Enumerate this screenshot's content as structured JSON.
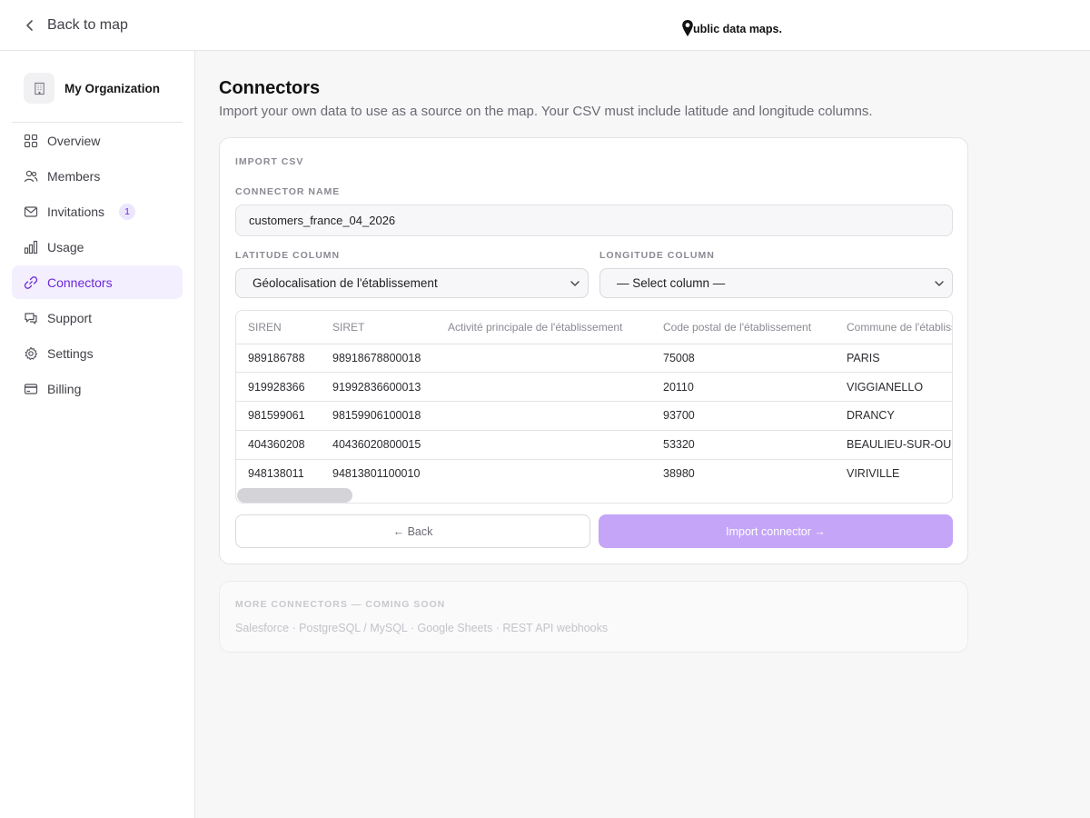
{
  "topbar": {
    "back_label": "Back to map",
    "brand": "ublic data maps."
  },
  "sidebar": {
    "org_name": "My Organization",
    "items": [
      {
        "label": "Overview",
        "icon": "grid-icon"
      },
      {
        "label": "Members",
        "icon": "users-icon"
      },
      {
        "label": "Invitations",
        "icon": "mail-icon",
        "badge": "1"
      },
      {
        "label": "Usage",
        "icon": "bar-chart-icon"
      },
      {
        "label": "Connectors",
        "icon": "link-icon",
        "active": true
      },
      {
        "label": "Support",
        "icon": "chat-icon"
      },
      {
        "label": "Settings",
        "icon": "gear-icon"
      },
      {
        "label": "Billing",
        "icon": "credit-card-icon"
      }
    ]
  },
  "main": {
    "title": "Connectors",
    "subtitle": "Import your own data to use as a source on the map. Your CSV must include latitude and longitude columns.",
    "import": {
      "section_label": "IMPORT CSV",
      "name_label": "CONNECTOR NAME",
      "name_value": "customers_france_04_2026",
      "lat_label": "LATITUDE COLUMN",
      "lat_value": "Géolocalisation de l'établissement",
      "lon_label": "LONGITUDE COLUMN",
      "lon_value": "— Select column —",
      "table": {
        "headers": [
          "SIREN",
          "SIRET",
          "Activité principale de l'établissement",
          "Code postal de l'établissement",
          "Commune de l'établissement"
        ],
        "rows": [
          [
            "989186788",
            "98918678800018",
            "",
            "75008",
            "PARIS"
          ],
          [
            "919928366",
            "91992836600013",
            "",
            "20110",
            "VIGGIANELLO"
          ],
          [
            "981599061",
            "98159906100018",
            "",
            "93700",
            "DRANCY"
          ],
          [
            "404360208",
            "40436020800015",
            "",
            "53320",
            "BEAULIEU-SUR-OUDON"
          ],
          [
            "948138011",
            "94813801100010",
            "",
            "38980",
            "VIRIVILLE"
          ]
        ]
      },
      "back_button": "← Back",
      "import_button": "Import connector →"
    },
    "coming_soon": {
      "label": "MORE CONNECTORS — COMING SOON",
      "list": "Salesforce · PostgreSQL / MySQL · Google Sheets · REST API webhooks"
    }
  },
  "colors": {
    "accent": "#6d28d9",
    "active_bg": "#f3effe",
    "import_button": "#c4a5f7"
  }
}
